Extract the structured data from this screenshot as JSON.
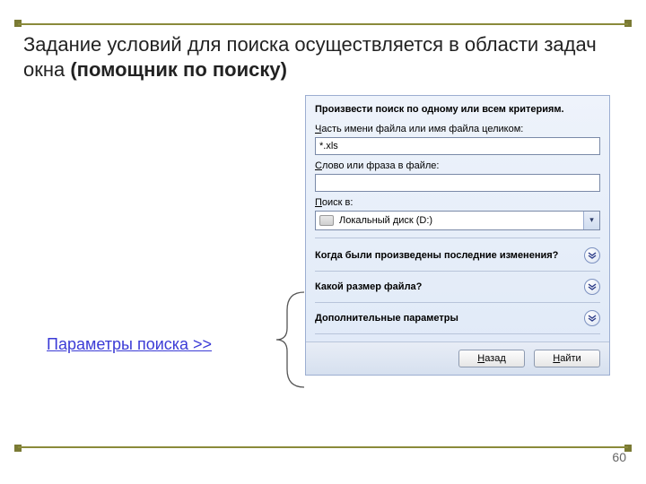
{
  "slide": {
    "title_plain": "Задание условий для поиска осуществляется в области задач окна ",
    "title_bold": "(помощник по поиску)",
    "page_number": "60"
  },
  "link": {
    "params": "Параметры поиска  >>"
  },
  "panel": {
    "heading": "Произвести поиск по одному или всем критериям.",
    "filename_label_u": "Ч",
    "filename_label_rest": "асть имени файла или имя файла целиком:",
    "filename_value": "*.xls",
    "phrase_label_u": "С",
    "phrase_label_rest": "лово или фраза в файле:",
    "phrase_value": "",
    "lookin_label_u": "П",
    "lookin_label_rest": "оиск в:",
    "lookin_value": "Локальный диск (D:)",
    "exp_when": "Когда были произведены последние изменения?",
    "exp_size": "Какой размер файла?",
    "exp_more": "Дополнительные параметры",
    "btn_back_u": "Н",
    "btn_back_rest": "азад",
    "btn_find_u": "Н",
    "btn_find_rest": "айти"
  }
}
